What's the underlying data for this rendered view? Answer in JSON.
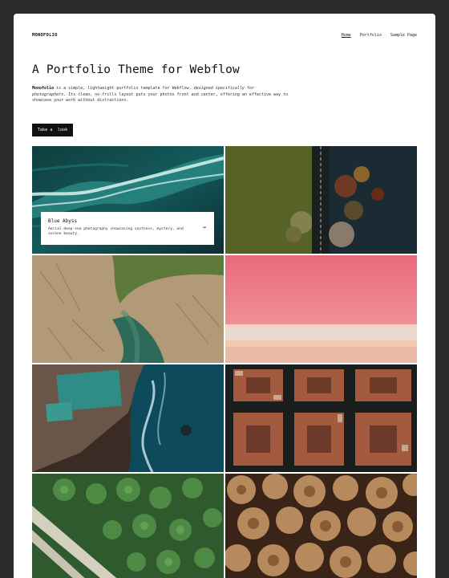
{
  "nav": {
    "logo": "MONOFOLIO",
    "links": [
      "Home",
      "Portfolio",
      "Sample Page"
    ],
    "active": "Home"
  },
  "hero": {
    "title": "A Portfolio Theme for Webflow",
    "desc_brand": "Monofolio",
    "desc_part1": " is a simple, lightweight portfolio template for Webflow, ",
    "desc_em": "designed specifically for photographers",
    "desc_part2": ". Its clean, no-frills layout puts your photos front and center, offering an effective way to showcase your work without distractions.",
    "cta_label": "Take a  look"
  },
  "gallery": {
    "featured": {
      "title": "Blue Abyss",
      "description": "Aerial deep-sea photography showcasing vastness, mystery, and serene beauty.",
      "arrow": "→"
    },
    "tiles": [
      {
        "name": "ocean-waves-photo"
      },
      {
        "name": "forest-road-photo"
      },
      {
        "name": "dry-grass-lagoon-photo"
      },
      {
        "name": "pink-beach-photo"
      },
      {
        "name": "coastal-pool-photo"
      },
      {
        "name": "city-blocks-photo"
      },
      {
        "name": "palm-trees-road-photo"
      },
      {
        "name": "firewood-logs-photo"
      }
    ]
  },
  "colors": {
    "background": "#2c2c2c",
    "card": "#ffffff",
    "button": "#111111"
  }
}
